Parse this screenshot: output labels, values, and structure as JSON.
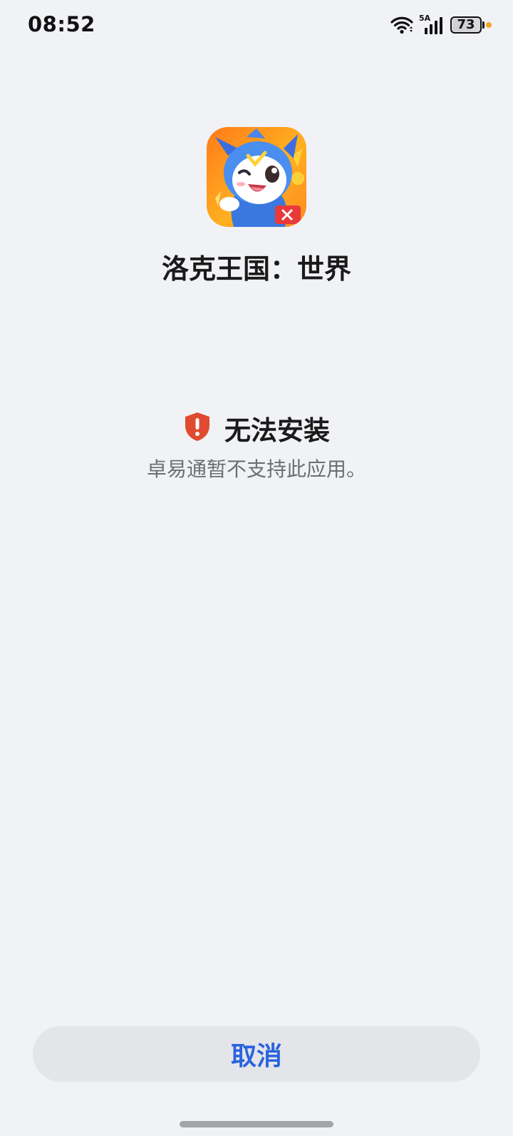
{
  "status_bar": {
    "time": "08:52",
    "network_type": "5A",
    "battery_level": "73",
    "battery_percent": 73,
    "charging_dot_color": "#f5a623"
  },
  "app": {
    "name": "洛克王国：世界",
    "icon": "roco-kingdom-app-icon"
  },
  "warning": {
    "icon": "shield-alert-icon",
    "icon_color": "#e04a2f",
    "title": "无法安装",
    "message": "卓易通暂不支持此应用。"
  },
  "actions": {
    "cancel_label": "取消",
    "cancel_color": "#2a63e0"
  }
}
